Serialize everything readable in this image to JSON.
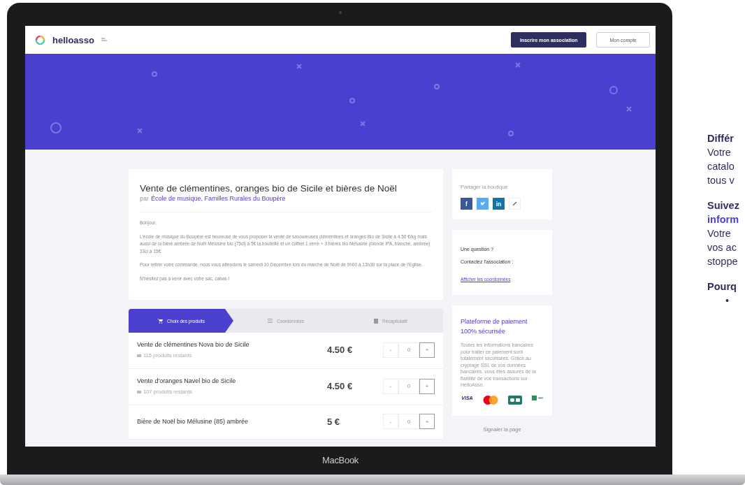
{
  "header": {
    "logo": "helloasso",
    "buttons": [
      {
        "label": "Inscrire mon association",
        "kind": "primary"
      },
      {
        "label": "Mon compte",
        "kind": "secondary"
      }
    ]
  },
  "campaign": {
    "title": "Vente de clémentines, oranges bio de Sicile et bières de Noël",
    "by": "par",
    "organizer": "École de musique, Familles Rurales du Boupère",
    "paragraphs": [
      "Bonjour,",
      "L'école de musique du Boupère est heureuse de vous proposer la vente de savoureuses clémentines et oranges Bio de Sicile à 4.50 €/kg mais aussi de la bière ambrée de Noël Mélusine bio (75cl) à 5€ la bouteille et un coffret 1 verre + 3 bières bio Mélusine (blonde IPA, blanche, ambrée) 33cl à 15€.",
      "Pour retirer votre commande, nous vous attendons le samedi 10 Décembre lors du marché de Noël de 9h00 à 13h30 sur la place de l'Eglise.",
      "N'hésitez pas à venir avec votre sac, cabas !"
    ]
  },
  "steps": [
    {
      "label": "Choix des produits",
      "kind": "cart",
      "selected": true
    },
    {
      "label": "Coordonnées",
      "kind": "list",
      "selected": false
    },
    {
      "label": "Récapitulatif",
      "kind": "summary",
      "selected": false
    }
  ],
  "products": [
    {
      "name": "Vente de clémentines Nova bio de Sicile",
      "stock": "115 produits restants",
      "price": "4.50 €",
      "quantity": "0"
    },
    {
      "name": "Vente d'oranges Navel bio de Sicile",
      "stock": "107 produits restants",
      "price": "4.50 €",
      "quantity": "0"
    },
    {
      "name": "Bière de Noël bio Mélusine (85) ambrée",
      "price": "5 €",
      "quantity": "0"
    }
  ],
  "qty_buttons": {
    "minus": "-",
    "plus": "+"
  },
  "share": {
    "title": "Partager la boutique",
    "networks": [
      {
        "kind": "facebook",
        "label": "f",
        "color": "#3b5998"
      },
      {
        "kind": "twitter",
        "color": "#55acee"
      },
      {
        "kind": "linkedin",
        "label": "in",
        "color": "#0e76a8"
      },
      {
        "kind": "link"
      }
    ]
  },
  "contact": {
    "lines": [
      "Une question ?",
      "Contactez l'association :"
    ],
    "link": "Afficher les coordonnées"
  },
  "security": {
    "title": "Plateforme de paiement 100% sécurisée",
    "text": "Toutes les informations bancaires pour traiter ce paiement sont totalement sécurisées. Grâce au cryptage SSL de vos données bancaires, vous êtes assurés de la fiabilité de vos transactions sur HelloAsso.",
    "logos": [
      {
        "kind": "visa",
        "label": "VISA"
      },
      {
        "kind": "mastercard"
      },
      {
        "kind": "cb"
      },
      {
        "kind": "other"
      }
    ]
  },
  "report": "Signaler la page",
  "laptop_label": "MacBook",
  "side_text": [
    [
      {
        "text": "Différ",
        "kind": "heading"
      },
      {
        "text": "Votre",
        "kind": "body"
      },
      {
        "text": "catalo",
        "kind": "body"
      },
      {
        "text": "tous v",
        "kind": "body"
      }
    ],
    [
      {
        "text": "Suivez",
        "kind": "heading"
      },
      {
        "text": "inform",
        "kind": "accent"
      },
      {
        "text": "Votre",
        "kind": "body"
      },
      {
        "text": "vos ac",
        "kind": "body"
      },
      {
        "text": "stoppe",
        "kind": "body"
      }
    ],
    [
      {
        "text": "Pourq",
        "kind": "heading"
      },
      {
        "text": "•",
        "kind": "bullet"
      }
    ]
  ]
}
